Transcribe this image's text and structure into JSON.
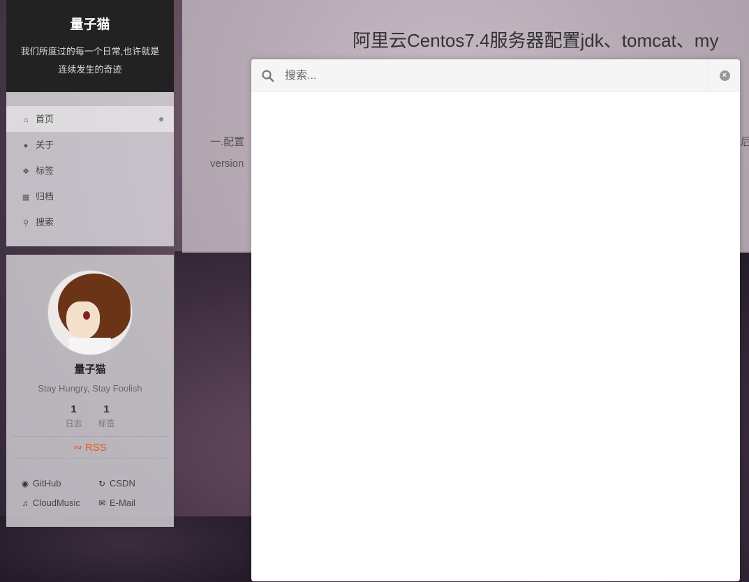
{
  "site": {
    "title": "量子猫",
    "subtitle": "我们所度过的每一个日常,也许就是连续发生的奇迹"
  },
  "menu": {
    "items": [
      {
        "label": "首页",
        "icon": "home-icon",
        "active": true
      },
      {
        "label": "关于",
        "icon": "user-icon"
      },
      {
        "label": "标签",
        "icon": "tags-icon"
      },
      {
        "label": "归档",
        "icon": "archive-icon"
      },
      {
        "label": "搜索",
        "icon": "search-icon"
      }
    ]
  },
  "profile": {
    "name": "量子猫",
    "motto": "Stay Hungry, Stay Foolish",
    "stats": [
      {
        "count": "1",
        "label": "日志"
      },
      {
        "count": "1",
        "label": "标签"
      }
    ],
    "rss": "RSS",
    "links": [
      {
        "label": "GitHub",
        "icon": "github-icon"
      },
      {
        "label": "CSDN",
        "icon": "refresh-icon"
      },
      {
        "label": "CloudMusic",
        "icon": "music-icon"
      },
      {
        "label": "E-Mail",
        "icon": "envelope-icon"
      }
    ]
  },
  "post": {
    "title": "阿里云Centos7.4服务器配置jdk、tomcat、my",
    "body_line1": "一.配置",
    "body_line1_tail": "后",
    "body_line2": "version"
  },
  "search": {
    "placeholder": "搜索...",
    "value": ""
  },
  "colors": {
    "rss": "#e45a1b",
    "brand_bg": "#222222"
  }
}
